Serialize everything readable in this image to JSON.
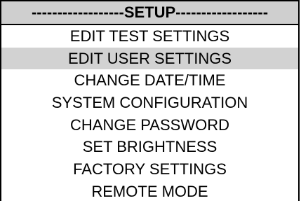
{
  "menu": {
    "title": "------------------SETUP------------------",
    "selected_index": 1,
    "items": [
      {
        "label": "EDIT TEST SETTINGS"
      },
      {
        "label": "EDIT USER SETTINGS"
      },
      {
        "label": "CHANGE DATE/TIME"
      },
      {
        "label": "SYSTEM CONFIGURATION"
      },
      {
        "label": "CHANGE PASSWORD"
      },
      {
        "label": "SET BRIGHTNESS"
      },
      {
        "label": "FACTORY SETTINGS"
      },
      {
        "label": "REMOTE MODE"
      }
    ]
  },
  "colors": {
    "header_bg": "#cfcfcf",
    "selected_bg": "#d2d2d2",
    "text": "#000000",
    "border": "#000000",
    "background": "#ffffff"
  }
}
